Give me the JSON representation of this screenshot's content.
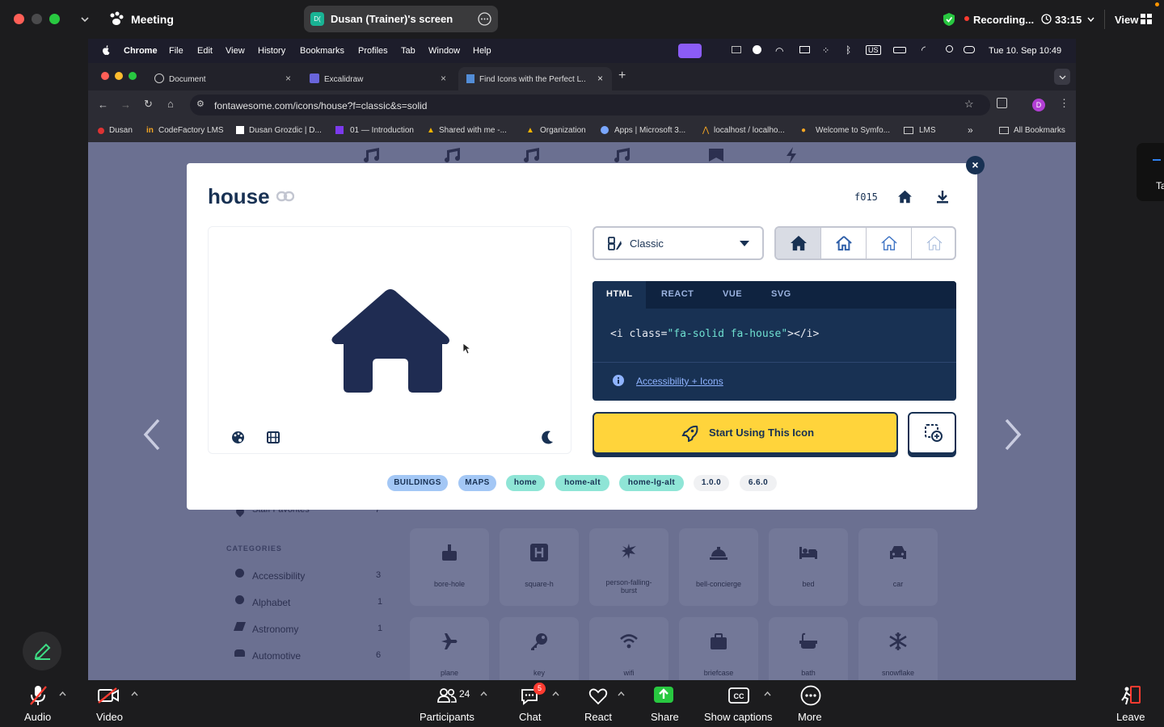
{
  "zoom": {
    "meeting_label": "Meeting",
    "share_title": "Dusan (Trainer)'s screen",
    "share_badge": "D(",
    "recording_label": "Recording...",
    "timer": "33:15",
    "view_label": "View",
    "bottom": {
      "audio": "Audio",
      "video": "Video",
      "participants": "Participants",
      "participants_count": "24",
      "chat": "Chat",
      "chat_badge": "5",
      "react": "React",
      "share": "Share",
      "captions": "Show captions",
      "more": "More",
      "leave": "Leave"
    },
    "side_peek": "Ta"
  },
  "mac": {
    "app": "Chrome",
    "menu": [
      "File",
      "Edit",
      "View",
      "History",
      "Bookmarks",
      "Profiles",
      "Tab",
      "Window",
      "Help"
    ],
    "clock": "Tue 10. Sep  10:49",
    "input_source": "US"
  },
  "browser": {
    "tabs": [
      {
        "title": "Document"
      },
      {
        "title": "Excalidraw"
      },
      {
        "title": "Find Icons with the Perfect L..."
      }
    ],
    "url": "fontawesome.com/icons/house?f=classic&s=solid",
    "profile_initial": "D",
    "bookmarks": [
      "Dusan",
      "CodeFactory LMS",
      "Dusan Grozdic | D...",
      "01 — Introduction",
      "Shared with me -...",
      "Organization",
      "Apps | Microsoft 3...",
      "localhost / localho...",
      "Welcome to Symfo...",
      "LMS"
    ],
    "all_bookmarks": "All Bookmarks"
  },
  "background_page": {
    "staff_favorites": "Staff Favorites",
    "staff_count": "7",
    "categories_heading": "CATEGORIES",
    "categories": [
      {
        "name": "Accessibility",
        "count": "3"
      },
      {
        "name": "Alphabet",
        "count": "1"
      },
      {
        "name": "Astronomy",
        "count": "1"
      },
      {
        "name": "Automotive",
        "count": "6"
      }
    ],
    "tiles_row1": [
      "bore-hole",
      "square-h",
      "person-falling-burst",
      "bell-concierge",
      "bed",
      "car"
    ],
    "tiles_row2": [
      "plane",
      "key",
      "wifi",
      "briefcase",
      "bath",
      "snowflake"
    ]
  },
  "modal": {
    "icon_name": "house",
    "unicode": "f015",
    "style_select": "Classic",
    "code_tabs": [
      "HTML",
      "REACT",
      "VUE",
      "SVG"
    ],
    "code_prefix": "<i class=",
    "code_string": "\"fa-solid fa-house\"",
    "code_suffix": "></i>",
    "a11y_link": "Accessibility + Icons",
    "start_button": "Start Using This Icon",
    "tags": [
      "BUILDINGS",
      "MAPS",
      "home",
      "home-alt",
      "home-lg-alt",
      "1.0.0",
      "6.6.0"
    ],
    "colors": {
      "navy": "#183153",
      "yellow": "#ffd43b",
      "tag_blue": "#a3c7f5",
      "tag_teal": "#8fe5d6",
      "tag_gray": "#f0f1f3"
    }
  }
}
